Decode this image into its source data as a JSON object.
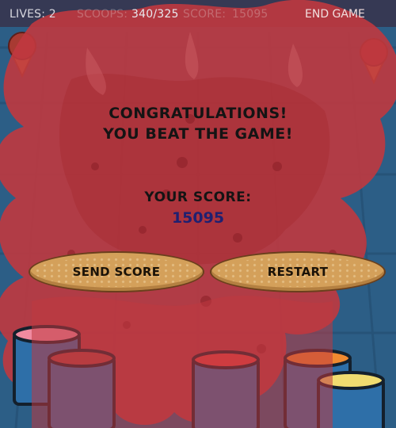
{
  "hud": {
    "lives_label": "LIVES: 2",
    "scoops_label": "SCOOPS:",
    "scoops_value": "340/325",
    "score_label": "SCORE:",
    "score_value": "15095",
    "end_game_label": "END GAME"
  },
  "result": {
    "line1": "CONGRATULATIONS!",
    "line2": "YOU BEAT THE GAME!",
    "score_label": "YOUR SCORE:",
    "score_value": "15095"
  },
  "buttons": {
    "send_score": "SEND SCORE",
    "restart": "RESTART"
  },
  "colors": {
    "background": "#2d5f86",
    "splat": "#c0393f",
    "cookie_button": "#d4a05a",
    "score_value": "#202070"
  },
  "icons": [
    "ice-cream-cone-icon",
    "paint-bucket-icon",
    "strawberry-splat-icon"
  ]
}
